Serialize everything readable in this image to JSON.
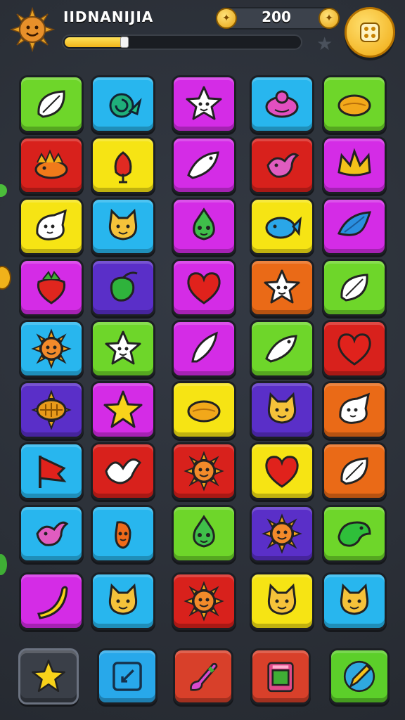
{
  "hud": {
    "title": "IIDNANIJIA",
    "score": "200",
    "xp_progress": 0.26,
    "icons": [
      "sun-avatar-icon",
      "coin-icon",
      "coin-icon",
      "star-icon",
      "menu-icon"
    ]
  },
  "colors": {
    "lime": "#6ed62a",
    "cyan": "#28b6ee",
    "magenta": "#d42ce6",
    "red": "#d8211c",
    "yellow": "#f6e414",
    "purple": "#5a2fc8",
    "orange": "#ea6a17",
    "board_bg": "#2b3038"
  },
  "board": {
    "rows": [
      [
        {
          "color": "lime",
          "icon": "leaf"
        },
        {
          "color": "cyan",
          "icon": "snail"
        },
        {
          "color": "magenta",
          "icon": "star-face"
        },
        {
          "color": "cyan",
          "icon": "blob"
        },
        {
          "color": "lime",
          "icon": "lemon"
        }
      ],
      [
        {
          "color": "red",
          "icon": "sun-fish"
        },
        {
          "color": "yellow",
          "icon": "chili"
        },
        {
          "color": "magenta",
          "icon": "fish"
        },
        {
          "color": "red",
          "icon": "bird"
        },
        {
          "color": "magenta",
          "icon": "crown"
        }
      ],
      [
        {
          "color": "yellow",
          "icon": "ghost"
        },
        {
          "color": "cyan",
          "icon": "cat-face"
        },
        {
          "color": "magenta",
          "icon": "alien"
        },
        {
          "color": "yellow",
          "icon": "whale"
        },
        {
          "color": "magenta",
          "icon": "wing"
        }
      ],
      [
        {
          "color": "magenta",
          "icon": "strawberry"
        },
        {
          "color": "purple",
          "icon": "sprout"
        },
        {
          "color": "magenta",
          "icon": "heart"
        },
        {
          "color": "orange",
          "icon": "star-face"
        },
        {
          "color": "lime",
          "icon": "leaf"
        }
      ],
      [
        {
          "color": "cyan",
          "icon": "sun-face"
        },
        {
          "color": "lime",
          "icon": "star-face"
        },
        {
          "color": "magenta",
          "icon": "feather"
        },
        {
          "color": "lime",
          "icon": "fish"
        },
        {
          "color": "red",
          "icon": "heart"
        }
      ],
      [
        {
          "color": "purple",
          "icon": "sun"
        },
        {
          "color": "magenta",
          "icon": "star"
        },
        {
          "color": "yellow",
          "icon": "lemon"
        },
        {
          "color": "purple",
          "icon": "cat-face"
        },
        {
          "color": "orange",
          "icon": "ghost"
        }
      ],
      [
        {
          "color": "cyan",
          "icon": "flag"
        },
        {
          "color": "red",
          "icon": "dove"
        },
        {
          "color": "red",
          "icon": "sun-face"
        },
        {
          "color": "yellow",
          "icon": "heart"
        },
        {
          "color": "orange",
          "icon": "leaf"
        }
      ],
      [
        {
          "color": "cyan",
          "icon": "bird"
        },
        {
          "color": "cyan",
          "icon": "pepper"
        },
        {
          "color": "lime",
          "icon": "alien"
        },
        {
          "color": "purple",
          "icon": "sun-face"
        },
        {
          "color": "lime",
          "icon": "dino"
        }
      ],
      [
        {
          "color": "magenta",
          "icon": "banana"
        },
        {
          "color": "cyan",
          "icon": "cat-face"
        },
        {
          "color": "red",
          "icon": "sun-face"
        },
        {
          "color": "yellow",
          "icon": "cat-face"
        },
        {
          "color": "cyan",
          "icon": "cat-face"
        }
      ]
    ]
  },
  "toolbar": {
    "buttons": [
      {
        "name": "star-tool-button",
        "color": "dark",
        "icon": "star"
      },
      {
        "name": "edit-tool-button",
        "color": "cyan",
        "icon": "edit"
      },
      {
        "name": "brush-tool-button",
        "color": "red",
        "icon": "brush"
      },
      {
        "name": "shuffle-tool-button",
        "color": "red",
        "icon": "box"
      },
      {
        "name": "pencil-tool-button",
        "color": "lime",
        "icon": "pencil"
      }
    ]
  }
}
